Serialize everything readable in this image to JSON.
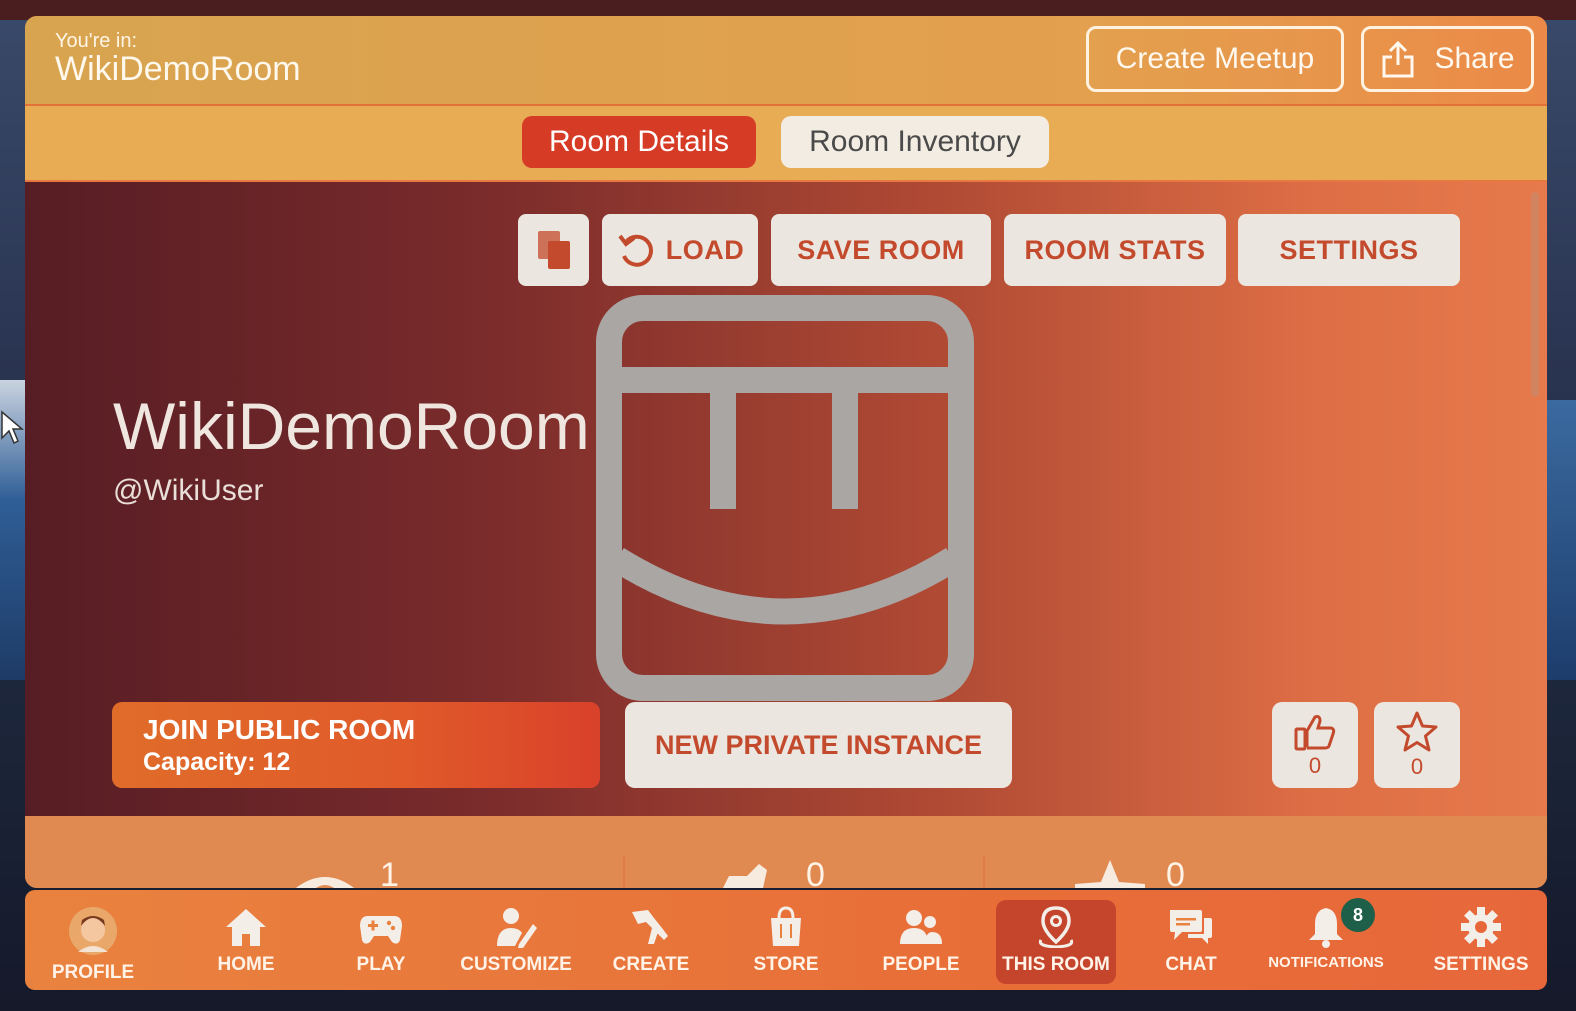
{
  "header": {
    "youre_in_label": "You're in:",
    "room_title": "WikiDemoRoom",
    "create_meetup_label": "Create Meetup",
    "share_label": "Share"
  },
  "tabs": [
    {
      "label": "Room Details",
      "active": true
    },
    {
      "label": "Room Inventory",
      "active": false
    }
  ],
  "toolbar": {
    "load_label": "LOAD",
    "save_room_label": "SAVE ROOM",
    "room_stats_label": "ROOM STATS",
    "settings_label": "SETTINGS"
  },
  "room": {
    "name": "WikiDemoRoom",
    "owner": "@WikiUser"
  },
  "actions": {
    "join_public_label": "JOIN PUBLIC ROOM",
    "capacity_text": "Capacity: 12",
    "new_private_label": "NEW PRIVATE INSTANCE",
    "cheers_count": "0",
    "favorites_count": "0"
  },
  "stats": {
    "visits": "1",
    "cheers": "0",
    "favorites": "0"
  },
  "nav": {
    "items": [
      {
        "label": "PROFILE",
        "icon": "avatar"
      },
      {
        "label": "HOME",
        "icon": "home-icon"
      },
      {
        "label": "PLAY",
        "icon": "gamepad-icon"
      },
      {
        "label": "CUSTOMIZE",
        "icon": "customize-icon"
      },
      {
        "label": "CREATE",
        "icon": "maker-pen-icon"
      },
      {
        "label": "STORE",
        "icon": "shopping-bag-icon"
      },
      {
        "label": "PEOPLE",
        "icon": "people-icon"
      },
      {
        "label": "THIS ROOM",
        "icon": "location-pin-icon"
      },
      {
        "label": "CHAT",
        "icon": "chat-icon"
      },
      {
        "label": "NOTIFICATIONS",
        "icon": "bell-icon"
      },
      {
        "label": "SETTINGS",
        "icon": "gear-icon"
      }
    ],
    "active": "THIS ROOM",
    "notifications_badge": "8"
  },
  "colors": {
    "accent_red": "#d63b26",
    "button_text": "#c34a2c",
    "header_gold": "#e3a04e",
    "badge_green": "#1d5f48"
  }
}
